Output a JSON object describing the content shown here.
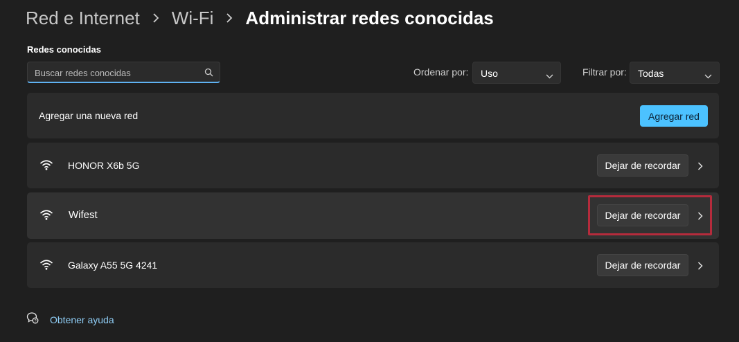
{
  "breadcrumb": {
    "items": [
      "Red e Internet",
      "Wi-Fi"
    ],
    "current": "Administrar redes conocidas"
  },
  "section_title": "Redes conocidas",
  "search": {
    "placeholder": "Buscar redes conocidas",
    "value": ""
  },
  "sort": {
    "label": "Ordenar por:",
    "value": "Uso"
  },
  "filter": {
    "label": "Filtrar por:",
    "value": "Todas"
  },
  "add_network": {
    "label": "Agregar una nueva red",
    "button": "Agregar red"
  },
  "networks": [
    {
      "name": "HONOR X6b 5G",
      "button": "Dejar de recordar"
    },
    {
      "name": "Wifest",
      "button": "Dejar de recordar"
    },
    {
      "name": "Galaxy A55 5G 4241",
      "button": "Dejar de recordar"
    }
  ],
  "help": {
    "label": "Obtener ayuda"
  },
  "colors": {
    "accent": "#4cc2ff",
    "highlight": "#b52b3c",
    "background": "#1f1f1f",
    "card": "#2b2b2b"
  }
}
